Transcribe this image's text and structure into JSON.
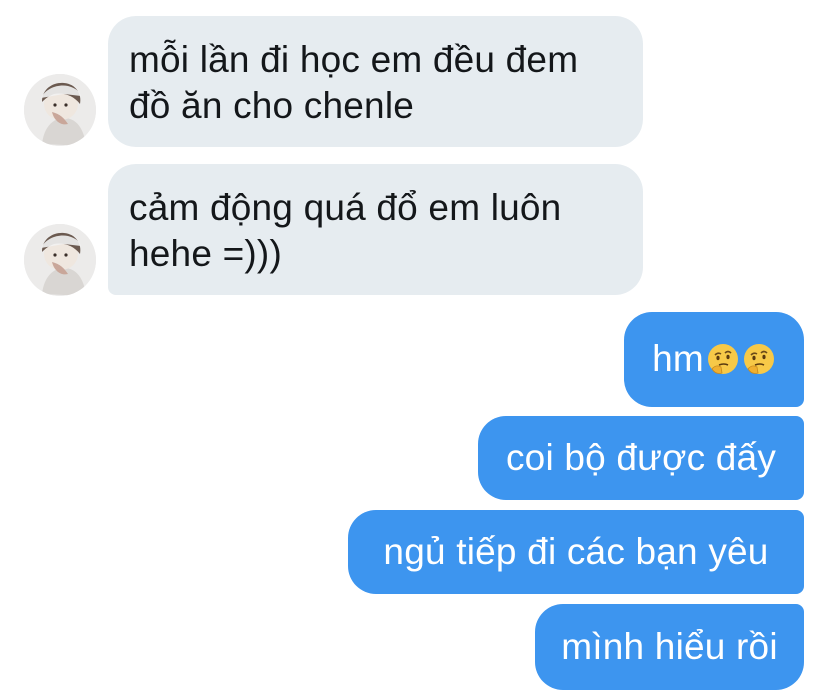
{
  "messages": [
    {
      "direction": "incoming",
      "lines": [
        "mỗi lần đi học em đều đem",
        "đồ ăn cho chenle"
      ],
      "avatar": "user-avatar-icon"
    },
    {
      "direction": "incoming",
      "lines": [
        "cảm động quá đổ em luôn",
        "hehe =)))"
      ],
      "avatar": "user-avatar-icon"
    },
    {
      "direction": "outgoing",
      "text": "hm",
      "emojis": [
        "thinking-face-icon",
        "thinking-face-icon"
      ]
    },
    {
      "direction": "outgoing",
      "text": "coi bộ được đấy"
    },
    {
      "direction": "outgoing",
      "text": "ngủ tiếp đi các bạn yêu"
    },
    {
      "direction": "outgoing",
      "text": "mình hiểu rồi"
    }
  ],
  "colors": {
    "incoming_bubble": "#e6ecf0",
    "incoming_text": "#14171a",
    "outgoing_bubble": "#3d95ef",
    "outgoing_text": "#ffffff"
  }
}
